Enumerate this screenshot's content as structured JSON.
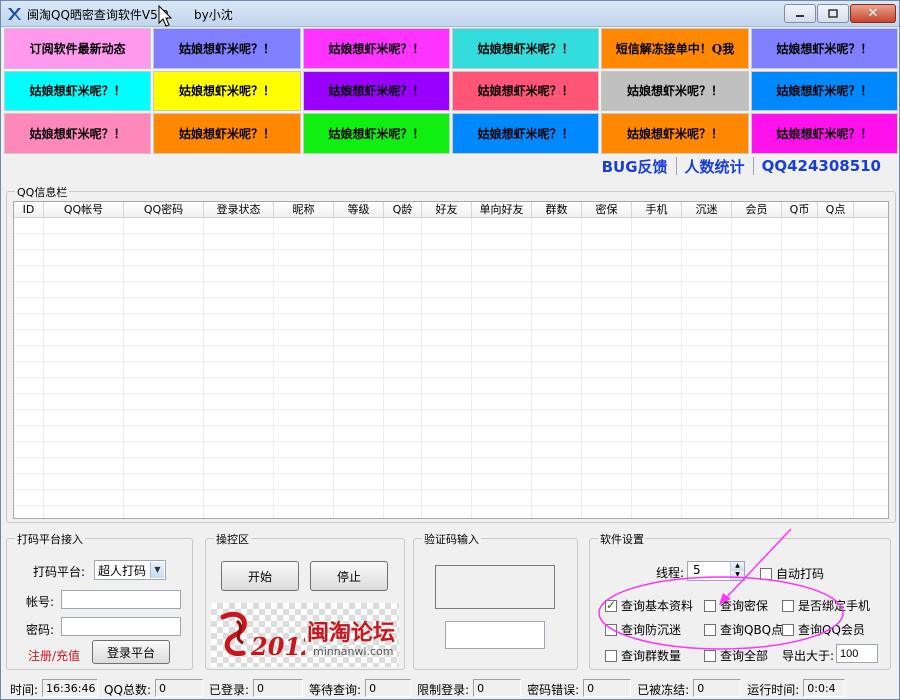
{
  "window": {
    "title": "闽淘QQ晒密查询软件V5.2",
    "author": "by小沈"
  },
  "banner": [
    {
      "text": "订阅软件最新动态",
      "bg": "#ff99ee"
    },
    {
      "text": "姑娘想虾米呢？！",
      "bg": "#8080ff"
    },
    {
      "text": "姑娘想虾米呢？！",
      "bg": "#ff33ff"
    },
    {
      "text": "姑娘想虾米呢？！",
      "bg": "#33dddd"
    },
    {
      "text": "短信解冻接单中！Q我",
      "bg": "#ff8800"
    },
    {
      "text": "姑娘想虾米呢？！",
      "bg": "#8080ff"
    },
    {
      "text": "姑娘想虾米呢？！",
      "bg": "#00ffff"
    },
    {
      "text": "姑娘想虾米呢？！",
      "bg": "#ffff00"
    },
    {
      "text": "姑娘想虾米呢？！",
      "bg": "#9900ff"
    },
    {
      "text": "姑娘想虾米呢？！",
      "bg": "#ff5577"
    },
    {
      "text": "姑娘想虾米呢？！",
      "bg": "#c0c0c0"
    },
    {
      "text": "姑娘想虾米呢？！",
      "bg": "#0088ff"
    },
    {
      "text": "姑娘想虾米呢？！",
      "bg": "#ff88bb"
    },
    {
      "text": "姑娘想虾米呢？！",
      "bg": "#ff8800"
    },
    {
      "text": "姑娘想虾米呢？！",
      "bg": "#11ee11"
    },
    {
      "text": "姑娘想虾米呢？！",
      "bg": "#0088ff"
    },
    {
      "text": "姑娘想虾米呢？！",
      "bg": "#ff8800"
    },
    {
      "text": "姑娘想虾米呢？！",
      "bg": "#ff11ee"
    }
  ],
  "links": {
    "bug": "BUG反馈",
    "stats": "人数统计",
    "qq": "QQ424308510"
  },
  "qqinfo": {
    "title": "QQ信息栏",
    "columns": [
      "ID",
      "QQ帐号",
      "QQ密码",
      "登录状态",
      "昵称",
      "等级",
      "Q龄",
      "好友",
      "单向好友",
      "群数",
      "密保",
      "手机",
      "沉迷",
      "会员",
      "Q币",
      "Q点"
    ]
  },
  "captcha_platform": {
    "title": "打码平台接入",
    "platform_label": "打码平台:",
    "platform_value": "超人打码",
    "account_label": "帐号:",
    "password_label": "密码:",
    "register_link": "注册/充值",
    "login_button": "登录平台"
  },
  "control": {
    "title": "操控区",
    "start": "开始",
    "stop": "停止",
    "logo_text": "闽淘论坛",
    "logo_url": "minnanwl.com"
  },
  "captcha_input": {
    "title": "验证码输入"
  },
  "settings": {
    "title": "软件设置",
    "threads_label": "线程:",
    "threads_value": "5",
    "auto_captcha": "自动打码",
    "options": [
      {
        "label": "查询基本资料",
        "checked": true
      },
      {
        "label": "查询密保",
        "checked": false
      },
      {
        "label": "是否绑定手机",
        "checked": false
      },
      {
        "label": "查询防沉迷",
        "checked": false
      },
      {
        "label": "查询QBQ点",
        "checked": false
      },
      {
        "label": "查询QQ会员",
        "checked": false
      },
      {
        "label": "查询群数量",
        "checked": false
      },
      {
        "label": "查询全部",
        "checked": false
      }
    ],
    "export_label": "导出大于:",
    "export_value": "100"
  },
  "status": {
    "time_label": "时间:",
    "time_value": "16:36:46",
    "total_label": "QQ总数:",
    "total_value": "0",
    "logged_label": "已登录:",
    "logged_value": "0",
    "waiting_label": "等待查询:",
    "waiting_value": "0",
    "limited_label": "限制登录:",
    "limited_value": "0",
    "pwderr_label": "密码错误:",
    "pwderr_value": "0",
    "frozen_label": "已被冻结:",
    "frozen_value": "0",
    "runtime_label": "运行时间:",
    "runtime_value": "0:0:4"
  }
}
